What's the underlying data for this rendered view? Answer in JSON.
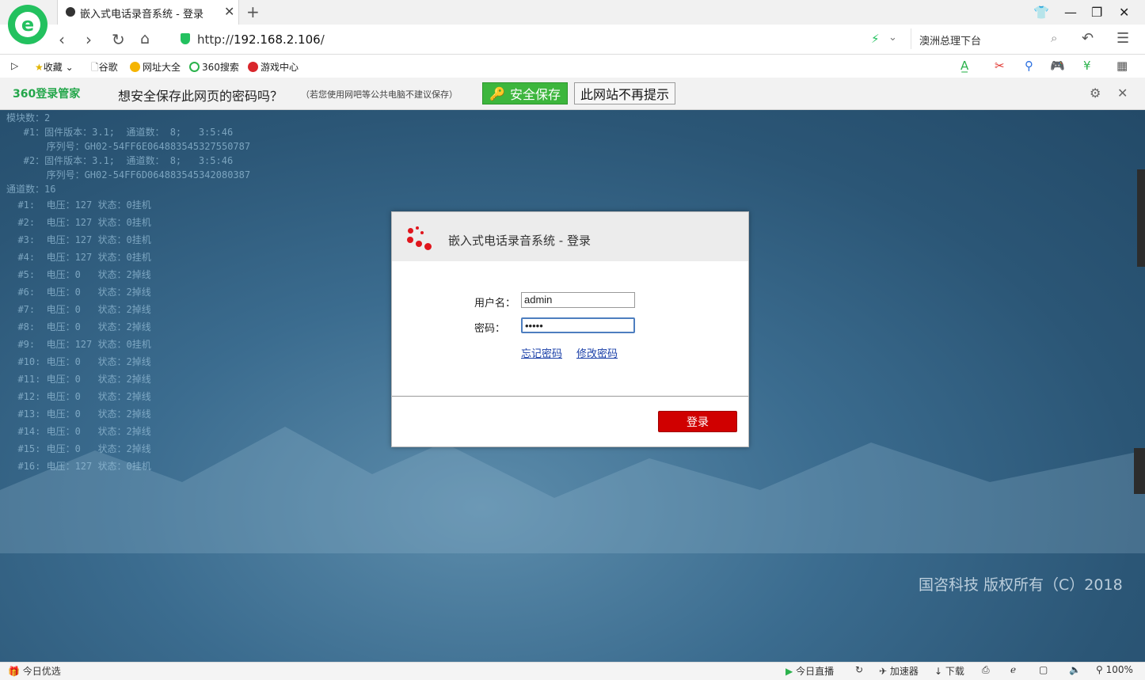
{
  "browser": {
    "tab_title": "嵌入式电话录音系统 - 登录",
    "url_prefix": "http://",
    "url_host": "192.168.2.106",
    "url_suffix": "/",
    "search_text": "澳洲总理下台",
    "logo_letter": "e"
  },
  "bookmarks": [
    {
      "label": "收藏"
    },
    {
      "label": "谷歌"
    },
    {
      "label": "网址大全"
    },
    {
      "label": "360搜索"
    },
    {
      "label": "游戏中心"
    }
  ],
  "password_bar": {
    "brand": "360登录管家",
    "question": "想安全保存此网页的密码吗？",
    "note": "（若您使用网吧等公共电脑不建议保存）",
    "save_label": "安全保存",
    "never_label": "此网站不再提示"
  },
  "device_status": {
    "modules_line": "模块数：2",
    "module1_fw": "   #1：固件版本：3.1;  通道数： 8;   3:5:46",
    "module1_sn": "       序列号：GH02-54FF6E064883545327550787",
    "module2_fw": "   #2：固件版本：3.1;  通道数： 8;   3:5:46",
    "module2_sn": "       序列号：GH02-54FF6D064883545342080387",
    "channels_line": "通道数：16",
    "channels": [
      "  #1:  电压：127 状态：0挂机",
      "  #2:  电压：127 状态：0挂机",
      "  #3:  电压：127 状态：0挂机",
      "  #4:  电压：127 状态：0挂机",
      "  #5:  电压：0   状态：2掉线",
      "  #6:  电压：0   状态：2掉线",
      "  #7:  电压：0   状态：2掉线",
      "  #8:  电压：0   状态：2掉线",
      "  #9:  电压：127 状态：0挂机",
      "  #10: 电压：0   状态：2掉线",
      "  #11: 电压：0   状态：2掉线",
      "  #12: 电压：0   状态：2掉线",
      "  #13: 电压：0   状态：2掉线",
      "  #14: 电压：0   状态：2掉线",
      "  #15: 电压：0   状态：2掉线",
      "  #16: 电压：127 状态：0挂机"
    ]
  },
  "login": {
    "title": "嵌入式电话录音系统 - 登录",
    "username_label": "用户名：",
    "username_value": "admin",
    "password_label": "密码：",
    "password_value": "•••••",
    "forgot_label": "忘记密码",
    "change_label": "修改密码",
    "submit_label": "登录"
  },
  "copyright": "国咨科技 版权所有（C）2018",
  "status_bar": {
    "left_label": "今日优选",
    "live_label": "今日直播",
    "accelerator_label": "加速器",
    "download_label": "下载",
    "zoom": "100%"
  },
  "colors": {
    "brand_green": "#23c15f",
    "login_red": "#d00000",
    "link_blue": "#1a3fa8"
  }
}
